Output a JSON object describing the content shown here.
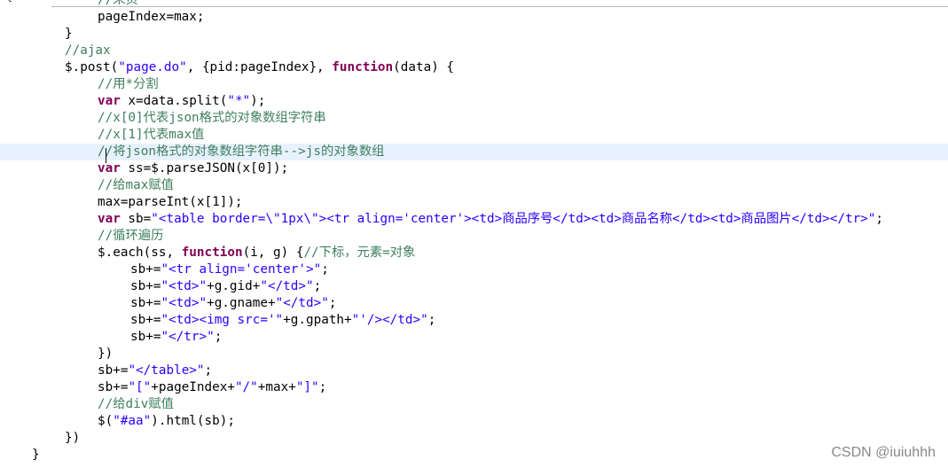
{
  "editor": {
    "top_fragment": "{",
    "lines": [
      {
        "indent": 110,
        "parts": [
          {
            "c": "cm",
            "t": "//末页"
          }
        ]
      },
      {
        "indent": 110,
        "parts": [
          {
            "c": "",
            "t": "pageIndex=max;"
          }
        ]
      },
      {
        "indent": 73,
        "parts": [
          {
            "c": "",
            "t": "}"
          }
        ]
      },
      {
        "indent": 73,
        "parts": [
          {
            "c": "cm",
            "t": "//ajax"
          }
        ]
      },
      {
        "indent": 73,
        "parts": [
          {
            "c": "",
            "t": "$.post("
          },
          {
            "c": "str",
            "t": "\"page.do\""
          },
          {
            "c": "",
            "t": ", {pid:pageIndex}, "
          },
          {
            "c": "kw",
            "t": "function"
          },
          {
            "c": "",
            "t": "(data) {"
          }
        ]
      },
      {
        "indent": 110,
        "parts": [
          {
            "c": "cm",
            "t": "//用*分割"
          }
        ]
      },
      {
        "indent": 110,
        "parts": [
          {
            "c": "kw",
            "t": "var"
          },
          {
            "c": "",
            "t": " x=data.split("
          },
          {
            "c": "str",
            "t": "\"*\""
          },
          {
            "c": "",
            "t": ");"
          }
        ]
      },
      {
        "indent": 110,
        "parts": [
          {
            "c": "cm",
            "t": "//x[0]代表json格式的对象数组字符串"
          }
        ]
      },
      {
        "indent": 110,
        "parts": [
          {
            "c": "cm",
            "t": "//x[1]代表max值"
          }
        ]
      },
      {
        "indent": 110,
        "current": true,
        "parts": [
          {
            "c": "cm",
            "t": "//将json格式的对象数组字符串-->js的对象数组"
          }
        ]
      },
      {
        "indent": 110,
        "parts": [
          {
            "c": "kw",
            "t": "var"
          },
          {
            "c": "",
            "t": " ss=$.parseJSON(x[0]);"
          }
        ]
      },
      {
        "indent": 110,
        "parts": [
          {
            "c": "cm",
            "t": "//给max赋值"
          }
        ]
      },
      {
        "indent": 110,
        "parts": [
          {
            "c": "",
            "t": "max=parseInt(x[1]);"
          }
        ]
      },
      {
        "indent": 110,
        "parts": [
          {
            "c": "kw",
            "t": "var"
          },
          {
            "c": "",
            "t": " sb="
          },
          {
            "c": "str",
            "t": "\"<table border=\\\"1px\\\"><tr align='center'><td>商品序号</td><td>商品名称</td><td>商品图片</td></tr>\""
          },
          {
            "c": "",
            "t": ";"
          }
        ]
      },
      {
        "indent": 110,
        "parts": [
          {
            "c": "cm",
            "t": "//循环遍历"
          }
        ]
      },
      {
        "indent": 110,
        "parts": [
          {
            "c": "",
            "t": "$.each(ss, "
          },
          {
            "c": "kw",
            "t": "function"
          },
          {
            "c": "",
            "t": "(i, g) {"
          },
          {
            "c": "cm",
            "t": "//下标，元素=对象"
          }
        ]
      },
      {
        "indent": 147,
        "parts": [
          {
            "c": "",
            "t": "sb+="
          },
          {
            "c": "str",
            "t": "\"<tr align='center'>\""
          },
          {
            "c": "",
            "t": ";"
          }
        ]
      },
      {
        "indent": 147,
        "parts": [
          {
            "c": "",
            "t": "sb+="
          },
          {
            "c": "str",
            "t": "\"<td>\""
          },
          {
            "c": "",
            "t": "+g.gid+"
          },
          {
            "c": "str",
            "t": "\"</td>\""
          },
          {
            "c": "",
            "t": ";"
          }
        ]
      },
      {
        "indent": 147,
        "parts": [
          {
            "c": "",
            "t": "sb+="
          },
          {
            "c": "str",
            "t": "\"<td>\""
          },
          {
            "c": "",
            "t": "+g.gname+"
          },
          {
            "c": "str",
            "t": "\"</td>\""
          },
          {
            "c": "",
            "t": ";"
          }
        ]
      },
      {
        "indent": 147,
        "parts": [
          {
            "c": "",
            "t": "sb+="
          },
          {
            "c": "str",
            "t": "\"<td><img src='\""
          },
          {
            "c": "",
            "t": "+g.gpath+"
          },
          {
            "c": "str",
            "t": "\"'/></td>\""
          },
          {
            "c": "",
            "t": ";"
          }
        ]
      },
      {
        "indent": 147,
        "parts": [
          {
            "c": "",
            "t": "sb+="
          },
          {
            "c": "str",
            "t": "\"</tr>\""
          },
          {
            "c": "",
            "t": ";"
          }
        ]
      },
      {
        "indent": 110,
        "parts": [
          {
            "c": "",
            "t": "})"
          }
        ]
      },
      {
        "indent": 110,
        "parts": [
          {
            "c": "",
            "t": "sb+="
          },
          {
            "c": "str",
            "t": "\"</table>\""
          },
          {
            "c": "",
            "t": ";"
          }
        ]
      },
      {
        "indent": 110,
        "parts": [
          {
            "c": "",
            "t": "sb+="
          },
          {
            "c": "str",
            "t": "\"[\""
          },
          {
            "c": "",
            "t": "+pageIndex+"
          },
          {
            "c": "str",
            "t": "\"/\""
          },
          {
            "c": "",
            "t": "+max+"
          },
          {
            "c": "str",
            "t": "\"]\""
          },
          {
            "c": "",
            "t": ";"
          }
        ]
      },
      {
        "indent": 110,
        "parts": [
          {
            "c": "cm",
            "t": "//给div赋值"
          }
        ]
      },
      {
        "indent": 110,
        "parts": [
          {
            "c": "",
            "t": "$("
          },
          {
            "c": "str",
            "t": "\"#aa\""
          },
          {
            "c": "",
            "t": ").html(sb);"
          }
        ]
      },
      {
        "indent": 73,
        "parts": [
          {
            "c": "",
            "t": "})"
          }
        ]
      },
      {
        "indent": 36,
        "parts": [
          {
            "c": "",
            "t": "}"
          }
        ]
      }
    ]
  },
  "watermark": "CSDN @iuiuhhh"
}
